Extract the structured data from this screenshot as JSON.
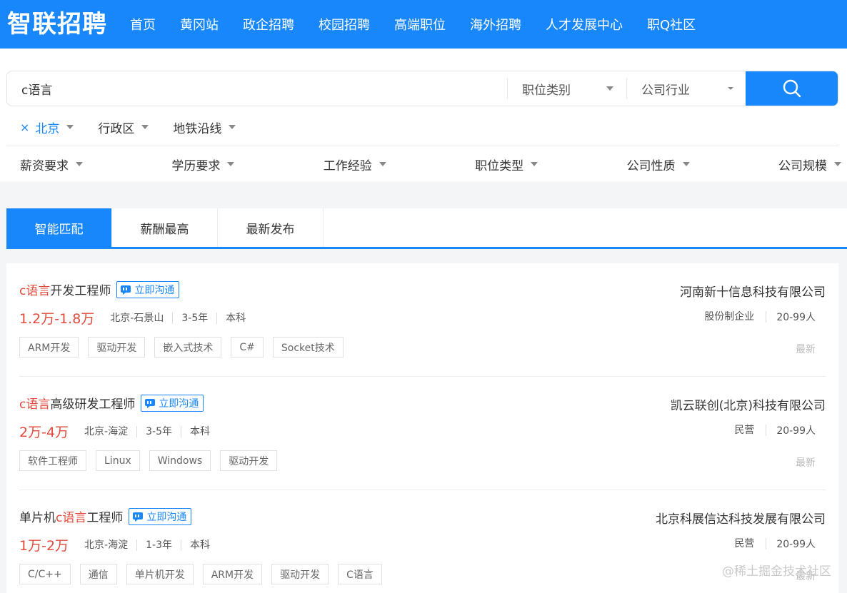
{
  "header": {
    "logo": "智联招聘",
    "nav": [
      "首页",
      "黄冈站",
      "政企招聘",
      "校园招聘",
      "高端职位",
      "海外招聘",
      "人才发展中心",
      "职Q社区"
    ]
  },
  "search": {
    "query": "c语言",
    "position_category": "职位类别",
    "industry": "公司行业"
  },
  "city_filters": {
    "city": "北京",
    "district": "行政区",
    "subway": "地铁沿线"
  },
  "filters": [
    "薪资要求",
    "学历要求",
    "工作经验",
    "职位类型",
    "公司性质",
    "公司规模"
  ],
  "tabs": [
    "智能匹配",
    "薪酬最高",
    "最新发布"
  ],
  "chat_label": "立即沟通",
  "jobs": [
    {
      "title_pre": "",
      "title_hl": "c语言",
      "title_post": "开发工程师",
      "salary": "1.2万-1.8万",
      "location": "北京-石景山",
      "experience": "3-5年",
      "education": "本科",
      "tags": [
        "ARM开发",
        "驱动开发",
        "嵌入式技术",
        "C#",
        "Socket技术"
      ],
      "company": "河南新十信息科技有限公司",
      "company_type": "股份制企业",
      "company_size": "20-99人",
      "fresh": "最新"
    },
    {
      "title_pre": "",
      "title_hl": "c语言",
      "title_post": "高级研发工程师",
      "salary": "2万-4万",
      "location": "北京-海淀",
      "experience": "3-5年",
      "education": "本科",
      "tags": [
        "软件工程师",
        "Linux",
        "Windows",
        "驱动开发"
      ],
      "company": "凯云联创(北京)科技有限公司",
      "company_type": "民营",
      "company_size": "20-99人",
      "fresh": "最新"
    },
    {
      "title_pre": "单片机",
      "title_hl": "c语言",
      "title_post": "工程师",
      "salary": "1万-2万",
      "location": "北京-海淀",
      "experience": "1-3年",
      "education": "本科",
      "tags": [
        "C/C++",
        "通信",
        "单片机开发",
        "ARM开发",
        "驱动开发",
        "C语言"
      ],
      "company": "北京科展信达科技发展有限公司",
      "company_type": "民营",
      "company_size": "20-99人",
      "fresh": "最新"
    }
  ],
  "watermark": "@稀土掘金技术社区",
  "colors": {
    "brand": "#1787fb",
    "highlight": "#e24a3b"
  }
}
